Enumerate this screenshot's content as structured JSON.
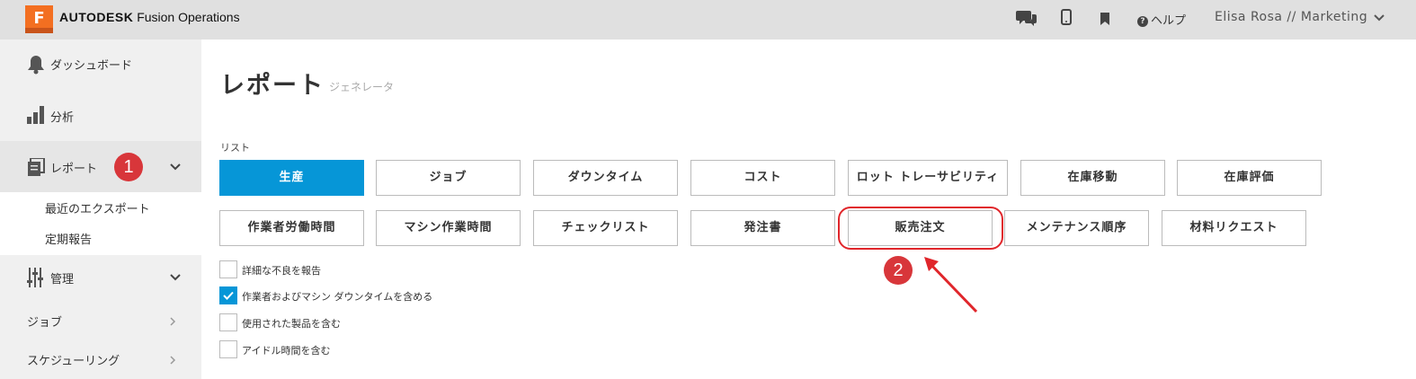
{
  "header": {
    "logo_letter": "F",
    "brand_bold": "AUTODESK",
    "brand_rest": " Fusion Operations",
    "help_label": "ヘルプ",
    "user_label": "Elisa Rosa // Marketing",
    "icons": [
      "chat-icon",
      "mobile-icon",
      "bookmark-icon",
      "help-icon",
      "chevron-down-icon"
    ]
  },
  "sidebar": {
    "items": [
      {
        "label": "ダッシュボード",
        "icon": "bell-icon"
      },
      {
        "label": "分析",
        "icon": "bar-chart-icon"
      },
      {
        "label": "レポート",
        "icon": "document-icon"
      },
      {
        "label": "管理",
        "icon": "sliders-icon"
      },
      {
        "label": "ジョブ"
      },
      {
        "label": "スケジューリング"
      }
    ],
    "sub_items": [
      "最近のエクスポート",
      "定期報告"
    ]
  },
  "page": {
    "title": "レポート",
    "subtitle": "ジェネレータ",
    "list_label": "リスト"
  },
  "report_buttons_row1": [
    "生産",
    "ジョブ",
    "ダウンタイム",
    "コスト",
    "ロット トレーサビリティ",
    "在庫移動",
    "在庫評価"
  ],
  "report_buttons_row2": [
    "作業者労働時間",
    "マシン作業時間",
    "チェックリスト",
    "発注書",
    "販売注文",
    "メンテナンス順序",
    "材料リクエスト"
  ],
  "active_report": "生産",
  "options": [
    {
      "label": "詳細な不良を報告",
      "checked": false
    },
    {
      "label": "作業者およびマシン ダウンタイムを含める",
      "checked": true
    },
    {
      "label": "使用された製品を含む",
      "checked": false
    },
    {
      "label": "アイドル時間を含む",
      "checked": false
    }
  ],
  "annotations": {
    "step1": "1",
    "step2": "2",
    "accent_color": "#d8363a"
  },
  "colors": {
    "primary": "#0696d7",
    "brand_orange": "#f36f21"
  }
}
